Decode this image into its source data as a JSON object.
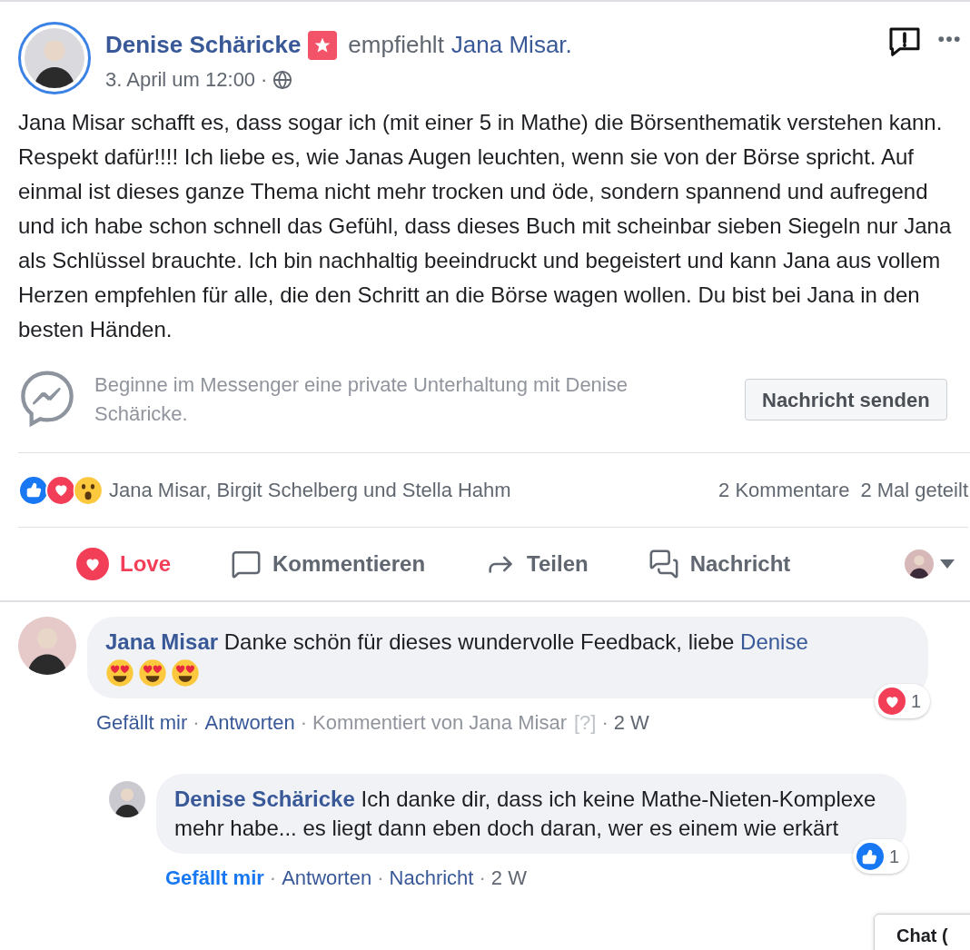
{
  "post": {
    "author": "Denise Schäricke",
    "verb": "empfiehlt",
    "target": "Jana Misar.",
    "time": "3. April um 12:00",
    "dot": "·",
    "text": "Jana Misar schafft es, dass sogar ich (mit einer 5 in Mathe) die Börsenthematik verstehen kann. Respekt dafür!!!! Ich liebe es, wie Janas Augen leuchten, wenn sie von der Börse spricht. Auf einmal ist dieses ganze Thema nicht mehr trocken und öde, sondern spannend und aufregend und ich habe schon schnell das Gefühl, dass dieses Buch mit scheinbar sieben Siegeln nur Jana als Schlüssel brauchte. Ich bin nachhaltig beeindruckt und begeistert und kann Jana aus vollem Herzen empfehlen für alle, die den Schritt an die Börse wagen wollen. Du bist bei Jana in den besten Händen."
  },
  "messenger": {
    "text": "Beginne im Messenger eine private Unterhaltung mit Denise Schäricke.",
    "button": "Nachricht senden"
  },
  "reactions": {
    "icons": [
      {
        "kind": "like"
      },
      {
        "kind": "love"
      },
      {
        "kind": "wow"
      }
    ],
    "names": "Jana Misar, Birgit Schelberg und Stella Hahm",
    "comments": "2 Kommentare",
    "shares": "2 Mal geteilt"
  },
  "actions": [
    {
      "kind": "love",
      "label": "Love",
      "selected": true
    },
    {
      "kind": "comment",
      "label": "Kommentieren",
      "selected": false
    },
    {
      "kind": "share",
      "label": "Teilen",
      "selected": false
    },
    {
      "kind": "message",
      "label": "Nachricht",
      "selected": false
    }
  ],
  "comments": [
    {
      "author": "Jana Misar",
      "text": "Danke schön für dieses wundervolle Feedback, liebe",
      "mention": "Denise",
      "emojis": [
        {
          "kind": "heart-eyes"
        },
        {
          "kind": "heart-eyes"
        },
        {
          "kind": "heart-eyes"
        }
      ],
      "reply": false,
      "reaction": {
        "kind": "love",
        "count": "1"
      },
      "meta": [
        {
          "text": "Gefällt mir",
          "kind": "link",
          "selected": false
        },
        {
          "text": "Antworten",
          "kind": "link",
          "selected": false
        },
        {
          "text": "Kommentiert von Jana Misar",
          "kind": "muted",
          "note": "[?]"
        },
        {
          "text": "2 W",
          "kind": "plain"
        }
      ]
    },
    {
      "author": "Denise Schäricke",
      "text": "Ich danke dir, dass ich keine Mathe-Nieten-Komplexe mehr habe... es liegt dann eben doch daran, wer es einem wie erkärt",
      "reply": true,
      "reaction": {
        "kind": "like",
        "count": "1"
      },
      "meta": [
        {
          "text": "Gefällt mir",
          "kind": "link",
          "selected": true
        },
        {
          "text": "Antworten",
          "kind": "link",
          "selected": false
        },
        {
          "text": "Nachricht",
          "kind": "link",
          "selected": false
        },
        {
          "text": "2 W",
          "kind": "plain"
        }
      ]
    }
  ],
  "chat": {
    "label": "Chat ("
  }
}
